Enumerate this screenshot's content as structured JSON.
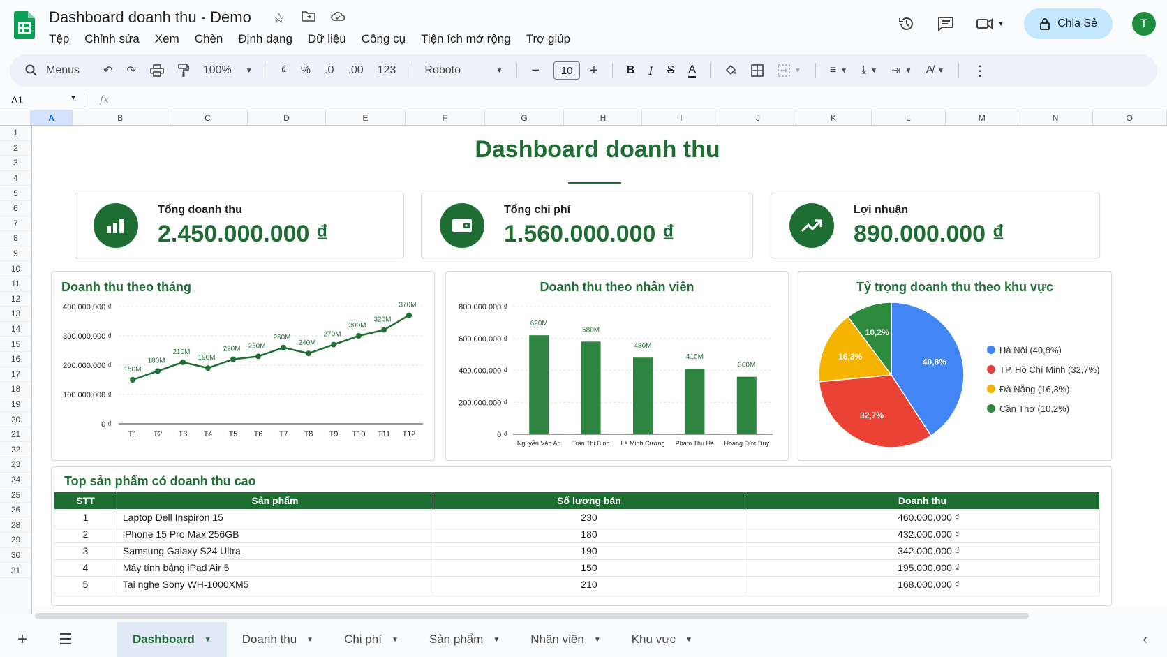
{
  "doc": {
    "title": "Dashboard doanh thu - Demo"
  },
  "menu": [
    "Tệp",
    "Chỉnh sửa",
    "Xem",
    "Chèn",
    "Định dạng",
    "Dữ liệu",
    "Công cụ",
    "Tiện ích mở rộng",
    "Trợ giúp"
  ],
  "header": {
    "share_label": "Chia Sẻ",
    "avatar_letter": "T"
  },
  "toolbar": {
    "search_label": "Menus",
    "zoom": "100%",
    "currency": "₫",
    "percent": "%",
    "dec_less": ".0",
    "dec_more": ".00",
    "format_123": "123",
    "font": "Roboto",
    "font_size": "10",
    "bold": "B",
    "italic": "I"
  },
  "formula_bar": {
    "cell_ref": "A1",
    "fx": "fx"
  },
  "columns": [
    "A",
    "B",
    "C",
    "D",
    "E",
    "F",
    "G",
    "H",
    "I",
    "J",
    "K",
    "L",
    "M",
    "N",
    "O"
  ],
  "rows": [
    "1",
    "2",
    "3",
    "4",
    "5",
    "6",
    "7",
    "8",
    "9",
    "10",
    "11",
    "12",
    "13",
    "14",
    "15",
    "16",
    "17",
    "18",
    "19",
    "20",
    "21",
    "22",
    "23",
    "24",
    "25",
    "26",
    "28",
    "29",
    "30",
    "31"
  ],
  "dashboard": {
    "title": "Dashboard doanh thu",
    "kpis": [
      {
        "label": "Tổng doanh thu",
        "value": "2.450.000.000 ₫"
      },
      {
        "label": "Tổng chi phí",
        "value": "1.560.000.000 ₫"
      },
      {
        "label": "Lợi nhuận",
        "value": "890.000.000 ₫"
      }
    ]
  },
  "chart_data": [
    {
      "type": "line",
      "title": "Doanh thu theo tháng",
      "categories": [
        "T1",
        "T2",
        "T3",
        "T4",
        "T5",
        "T6",
        "T7",
        "T8",
        "T9",
        "T10",
        "T11",
        "T12"
      ],
      "values": [
        150000000,
        180000000,
        210000000,
        190000000,
        220000000,
        230000000,
        260000000,
        240000000,
        270000000,
        300000000,
        320000000,
        370000000
      ],
      "data_labels": [
        "150M",
        "180M",
        "210M",
        "190M",
        "220M",
        "230M",
        "260M",
        "240M",
        "270M",
        "300M",
        "320M",
        "370M"
      ],
      "yticks": [
        "0 ₫",
        "100.000.000 ₫",
        "200.000.000 ₫",
        "300.000.000 ₫",
        "400.000.000 ₫"
      ],
      "ylim": [
        0,
        400000000
      ],
      "color": "#1e6e33"
    },
    {
      "type": "bar",
      "title": "Doanh thu theo nhân viên",
      "categories": [
        "Nguyễn Văn An",
        "Trần Thị Bình",
        "Lê Minh Cường",
        "Phạm Thu Hà",
        "Hoàng Đức Duy"
      ],
      "values": [
        620000000,
        580000000,
        480000000,
        410000000,
        360000000
      ],
      "data_labels": [
        "620M",
        "580M",
        "480M",
        "410M",
        "360M"
      ],
      "yticks": [
        "0 ₫",
        "200.000.000 ₫",
        "400.000.000 ₫",
        "600.000.000 ₫",
        "800.000.000 ₫"
      ],
      "ylim": [
        0,
        800000000
      ],
      "color": "#2e8540"
    },
    {
      "type": "pie",
      "title": "Tỷ trọng doanh thu theo khu vực",
      "slices": [
        {
          "name": "Hà Nội",
          "value": 40.8,
          "label": "40,8%",
          "legend": "Hà Nội (40,8%)",
          "color": "#4285f4"
        },
        {
          "name": "TP. Hồ Chí Minh",
          "value": 32.7,
          "label": "32,7%",
          "legend": "TP. Hồ Chí Minh (32,7%)",
          "color": "#ea4335"
        },
        {
          "name": "Đà Nẵng",
          "value": 16.3,
          "label": "16,3%",
          "legend": "Đà Nẵng (16,3%)",
          "color": "#f4b400"
        },
        {
          "name": "Cần Thơ",
          "value": 10.2,
          "label": "10,2%",
          "legend": "Cần Thơ (10,2%)",
          "color": "#2e8b3e"
        }
      ]
    }
  ],
  "top_products": {
    "title": "Top sản phẩm có doanh thu cao",
    "headers": [
      "STT",
      "Sản phẩm",
      "Số lượng bán",
      "Doanh thu"
    ],
    "rows": [
      [
        "1",
        "Laptop Dell Inspiron 15",
        "230",
        "460.000.000 ₫"
      ],
      [
        "2",
        "iPhone 15 Pro Max 256GB",
        "180",
        "432.000.000 ₫"
      ],
      [
        "3",
        "Samsung Galaxy S24 Ultra",
        "190",
        "342.000.000 ₫"
      ],
      [
        "4",
        "Máy tính bảng iPad Air  5",
        "150",
        "195.000.000 ₫"
      ],
      [
        "5",
        "Tai nghe Sony WH-1000XM5",
        "210",
        "168.000.000 ₫"
      ]
    ]
  },
  "sheet_tabs": [
    "Dashboard",
    "Doanh thu",
    "Chi phí",
    "Sản phẩm",
    "Nhân viên",
    "Khu vực"
  ],
  "colors": {
    "brand_green": "#1e6e33",
    "share_bg": "#c2e7ff"
  }
}
